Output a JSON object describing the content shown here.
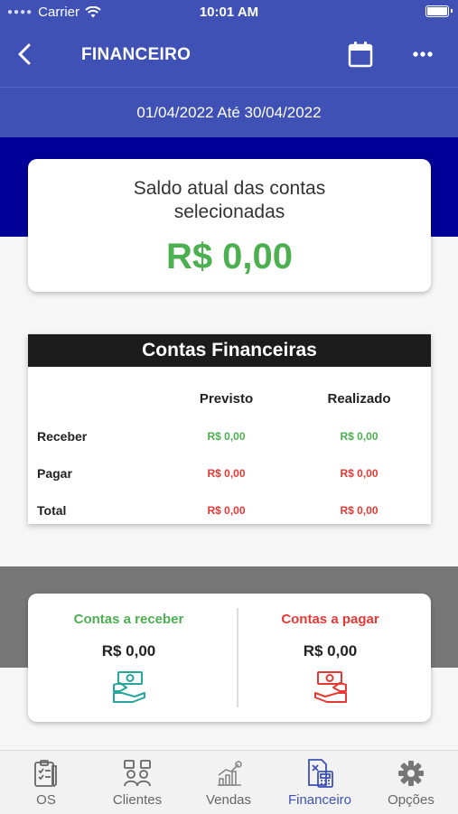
{
  "status": {
    "carrier": "Carrier",
    "time": "10:01 AM"
  },
  "header": {
    "title": "FINANCEIRO"
  },
  "period": {
    "text": "01/04/2022 Até 30/04/2022"
  },
  "saldo": {
    "label": "Saldo atual das contas selecionadas",
    "value": "R$ 0,00"
  },
  "contas": {
    "title": "Contas Financeiras",
    "columns": [
      "",
      "Previsto",
      "Realizado"
    ],
    "rows": [
      {
        "label": "Receber",
        "previsto": "R$ 0,00",
        "realizado": "R$ 0,00"
      },
      {
        "label": "Pagar",
        "previsto": "R$ 0,00",
        "realizado": "R$ 0,00"
      },
      {
        "label": "Total",
        "previsto": "R$ 0,00",
        "realizado": "R$ 0,00"
      }
    ]
  },
  "receber": {
    "title": "Contas a receber",
    "value": "R$ 0,00"
  },
  "pagar": {
    "title": "Contas a pagar",
    "value": "R$ 0,00"
  },
  "tabs": [
    {
      "label": "OS",
      "icon": "clipboard-icon"
    },
    {
      "label": "Clientes",
      "icon": "clients-icon"
    },
    {
      "label": "Vendas",
      "icon": "chart-icon"
    },
    {
      "label": "Financeiro",
      "icon": "calculator-icon"
    },
    {
      "label": "Opções",
      "icon": "gear-icon"
    }
  ],
  "colors": {
    "primary": "#3f51b5",
    "navy": "#000099",
    "green": "#4caf50",
    "red": "#e53935",
    "active_tab": "#3f51b5"
  }
}
